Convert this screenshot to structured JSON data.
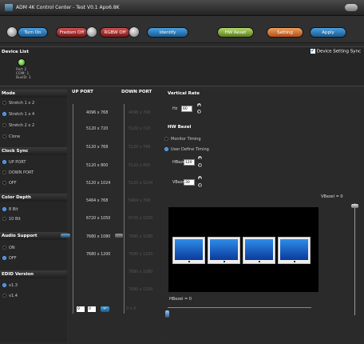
{
  "window": {
    "title": "ADM 4K Control Center - Test V0.1 Apo6.8K"
  },
  "toolbar": {
    "turn_on": "Turn On",
    "fredom_off": "Fredom Off",
    "rgbw_off": "RGBW Off",
    "identify": "Identify",
    "hw_reset": "HW Reset",
    "setting": "Setting",
    "apply": "Apply"
  },
  "device_list": {
    "title": "Device List",
    "sync_label": "Device Setting Sync",
    "sync_checked": true,
    "device_line1": "Port 2",
    "device_line2": "COM: 1",
    "device_line3": "BusID: 1"
  },
  "mode": {
    "title": "Mode",
    "options": [
      "Stretch 1 x 2",
      "Stretch 1 x 4",
      "Stretch 2 x 2",
      "Clone"
    ],
    "selected": 1
  },
  "clock_sync": {
    "title": "Clock Sync",
    "options": [
      "UP PORT",
      "DOWN PORT",
      "OFF"
    ],
    "selected": 0
  },
  "color_depth": {
    "title": "Color Depth",
    "options": [
      "8 Bit",
      "10 Bit"
    ],
    "selected": 0
  },
  "audio_support": {
    "title": "Audio Support",
    "options": [
      "ON",
      "OFF"
    ],
    "selected": 1
  },
  "edid_version": {
    "title": "EDID Version",
    "options": [
      "v1.3",
      "v1.4"
    ],
    "selected": 0
  },
  "ports": {
    "up_header": "UP PORT",
    "down_header": "DOWN PORT",
    "up": [
      "4096 x 768",
      "5120 x 720",
      "5120 x 768",
      "5120 x 800",
      "5120 x 1024",
      "5464 x 768",
      "6720 x 1050",
      "7680 x 1080",
      "7680 x 1200"
    ],
    "down": [
      "4096 x 768",
      "5120 x 720",
      "5120 x 768",
      "5120 x 800",
      "5120 x 1024",
      "5464 x 768",
      "6720 x 1050",
      "7680 x 1080",
      "7680 x 1200",
      "7680 x 1080",
      "7680 x 1200"
    ],
    "input_a": "0",
    "input_b": "0",
    "enter_glyph": "↵",
    "footer_text": "0 x 0"
  },
  "vertical_rate": {
    "title": "Vertical Rate",
    "hz_label": "Hz",
    "hz_value": "60"
  },
  "hw_bezel": {
    "title": "HW Bezel",
    "options": [
      "Monitor Timing",
      "User Define Timing"
    ],
    "selected": 1,
    "hbezel_label": "HBezel",
    "hbezel_value": "120",
    "vbezel_label": "VBezel",
    "vbezel_value": "30",
    "vbezel_readout": "VBezel = 0",
    "hbezel_readout": "HBezel = 0"
  },
  "icons": {
    "up": "▲",
    "down": "▼"
  },
  "colors": {
    "accent": "#3c8de0",
    "monitor_blue": "#1f6fd0"
  }
}
